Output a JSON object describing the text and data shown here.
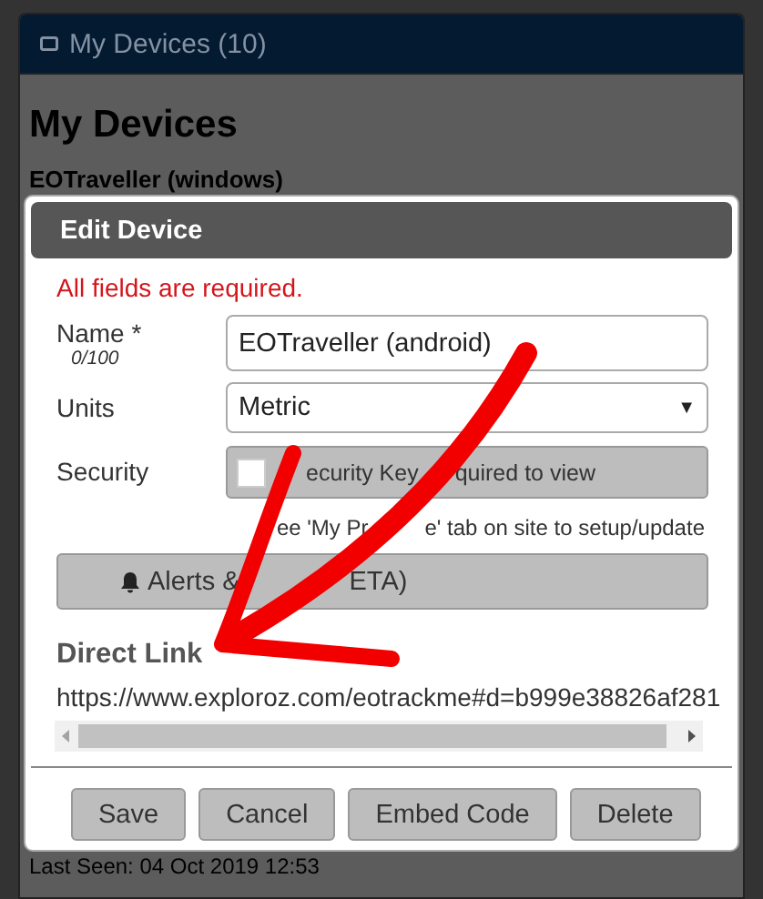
{
  "background": {
    "panel_title": "My Devices (10)",
    "heading": "My Devices",
    "device_name": "EOTraveller (windows)",
    "last_seen": "Last Seen: 04 Oct 2019 12:53"
  },
  "dialog": {
    "title": "Edit Device",
    "error": "All fields are required.",
    "fields": [
      {
        "kind": "text",
        "label": "Name *",
        "counter": "0/100",
        "value": "EOTraveller (android)"
      },
      {
        "kind": "select",
        "label": "Units",
        "value": "Metric",
        "caret": "▼"
      },
      {
        "kind": "checkbox",
        "label": "Security",
        "text_parts": [
          "ecurity Key",
          "quired to view"
        ],
        "checked": false,
        "note_parts": [
          "ee 'My Pr",
          "e' tab on site to setup/update"
        ]
      }
    ],
    "alerts_button_parts": [
      "Alerts &",
      "ETA)"
    ],
    "link_heading": "Direct Link",
    "link": "https://www.exploroz.com/eotrackme#d=b999e38826af281",
    "buttons": [
      "Save",
      "Cancel",
      "Embed Code",
      "Delete"
    ]
  }
}
